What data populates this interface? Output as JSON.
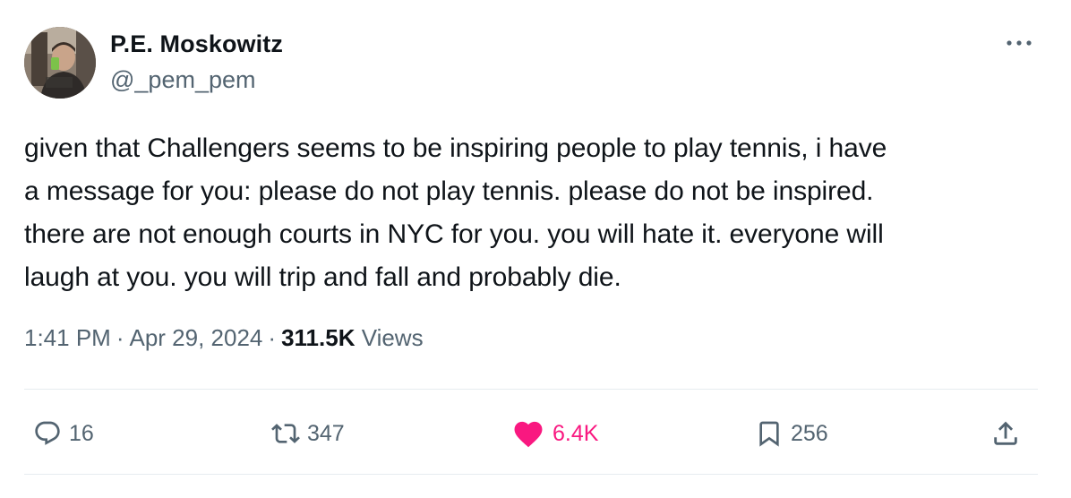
{
  "author": {
    "name": "P.E. Moskowitz",
    "handle": "@_pem_pem",
    "avatar_icon": "profile-photo"
  },
  "more_icon": "more-horizontal-icon",
  "tweet": {
    "text": "given that Challengers seems to be inspiring people to play tennis, i have\na message for you: please do not play tennis. please do not be inspired.\nthere are not enough courts in NYC for you. you will hate it. everyone will\nlaugh at you. you will trip and fall and probably die."
  },
  "meta": {
    "time": "1:41 PM",
    "separator": "·",
    "date": "Apr 29, 2024",
    "views_count": "311.5K",
    "views_label": "Views"
  },
  "actions": {
    "reply": {
      "count": "16",
      "icon": "reply-icon"
    },
    "retweet": {
      "count": "347",
      "icon": "retweet-icon"
    },
    "like": {
      "count": "6.4K",
      "icon": "heart-icon",
      "active": true
    },
    "bookmark": {
      "count": "256",
      "icon": "bookmark-icon"
    },
    "share": {
      "icon": "share-icon"
    }
  },
  "colors": {
    "text_primary": "#0f1419",
    "text_secondary": "#536471",
    "like_active": "#f91880",
    "divider": "#e6ecf0"
  }
}
